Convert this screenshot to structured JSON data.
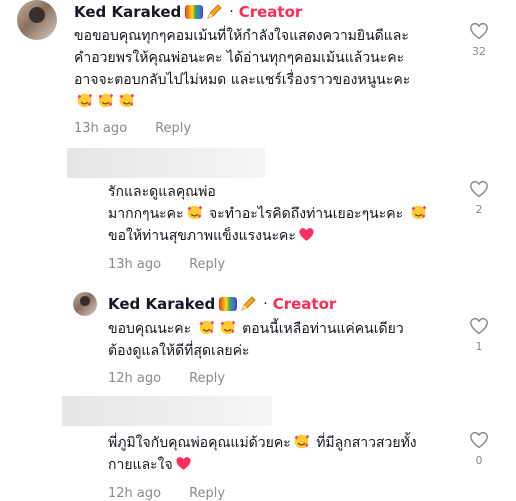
{
  "comments": [
    {
      "username": "Ked Karaked",
      "badge": "Creator",
      "lines": [
        "ขอขอบคุณทุกๆคอมเม้นที่ให้กำลังใจแสดงความยินดีและ",
        "คำอวยพรให้คุณพ่อนะคะ ได้อ่านทุกๆคอมเม้นแล้วนะคะ",
        "อาจจะตอบกลับไปไม่หมด และแชร์เรื่องราวของหนูนะคะ"
      ],
      "time": "13h ago",
      "reply": "Reply",
      "likes": "32"
    },
    {
      "lines": [
        "รักและดูแลคุณพ่อ",
        "มากกๆนะคะ",
        "จะทำอะไรคิดถึงท่านเยอะๆนะคะ",
        "ขอให้ท่านสุขภาพแข็งแรงนะคะ"
      ],
      "time": "13h ago",
      "reply": "Reply",
      "likes": "2"
    },
    {
      "username": "Ked Karaked",
      "badge": "Creator",
      "lines": [
        "ขอบคุณนะคะ",
        "ตอนนี้เหลือท่านแค่คนเดียว",
        "ต้องดูแลให้ดีที่สุดเลยค่ะ"
      ],
      "time": "12h ago",
      "reply": "Reply",
      "likes": "1"
    },
    {
      "lines": [
        "พี่ภูมิใจกับคุณพ่อคุณแม่ด้วยคะ",
        "ที่มีลูกสาวสวยทั้ง",
        "กายและใจ"
      ],
      "time": "12h ago",
      "reply": "Reply",
      "likes": "0"
    }
  ],
  "icons": {
    "heart_outline": "heart-outline-icon",
    "smiling_face_with_hearts": "smiling-face-with-hearts-emoji",
    "red_heart": "heart-emoji",
    "rainbow": "rainbow-icon",
    "pencil": "pencil-icon"
  },
  "colors": {
    "creator": "#fe2c55",
    "meta": "#8a8b91",
    "text": "#161823"
  }
}
